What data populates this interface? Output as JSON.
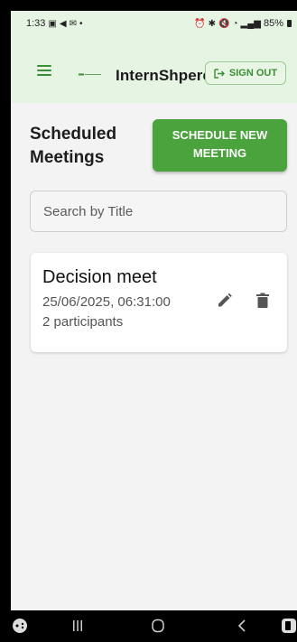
{
  "status_bar": {
    "time": "1:33",
    "battery": "85%"
  },
  "app_bar": {
    "brand": "InternShpere",
    "sign_out_label": "SIGN OUT",
    "accent_color": "#3a8f35",
    "background_color": "#e6f4e3"
  },
  "page": {
    "heading": "Scheduled Meetings",
    "schedule_button_label": "SCHEDULE NEW MEETING",
    "button_color": "#4aa33c"
  },
  "search": {
    "placeholder": "Search by Title",
    "value": ""
  },
  "meetings": [
    {
      "title": "Decision meet",
      "datetime": "25/06/2025, 06:31:00",
      "participants": "2 participants"
    }
  ],
  "icons": {
    "menu": "menu-icon",
    "logo": "logo-icon",
    "sign_out": "logout-icon",
    "edit": "pencil-icon",
    "delete": "trash-icon"
  }
}
